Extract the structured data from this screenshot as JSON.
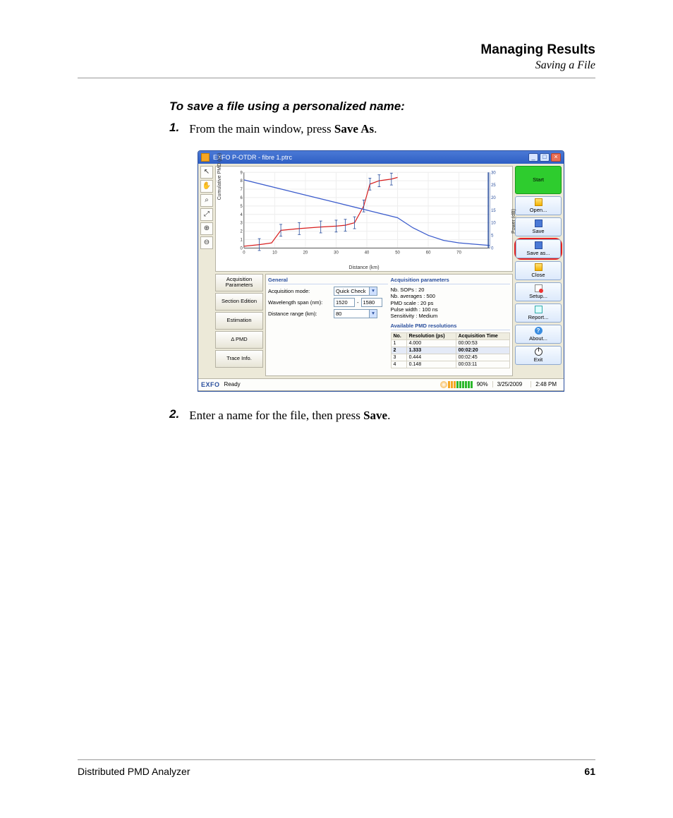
{
  "header": {
    "title": "Managing Results",
    "subtitle": "Saving a File"
  },
  "instruction_heading": "To save a file using a personalized name:",
  "steps": {
    "s1_num": "1.",
    "s1_pre": "From the main window, press ",
    "s1_b": "Save As",
    "s1_post": ".",
    "s2_num": "2.",
    "s2_pre": "Enter a name for the file, then press ",
    "s2_b": "Save",
    "s2_post": "."
  },
  "window": {
    "title": "EXFO P-OTDR - fibre 1.ptrc"
  },
  "chart_data": {
    "type": "line",
    "xlabel": "Distance (km)",
    "ylabel": "Cumulative PMD (ps)",
    "y2label": "Power (dB)",
    "xlim": [
      0,
      80
    ],
    "ylim": [
      0,
      9
    ],
    "y2lim": [
      0,
      30
    ],
    "x_ticks": [
      0,
      10,
      20,
      30,
      40,
      50,
      60,
      70
    ],
    "y_ticks": [
      0,
      1,
      2,
      3,
      4,
      5,
      6,
      7,
      8,
      9
    ],
    "y2_ticks": [
      0,
      5,
      10,
      15,
      20,
      25,
      30
    ],
    "series": [
      {
        "name": "Cumulative PMD",
        "axis": "y",
        "color": "#d81e1e",
        "x": [
          0,
          5,
          9,
          12,
          18,
          25,
          30,
          33,
          36,
          39,
          41,
          44,
          48,
          50
        ],
        "values": [
          0.2,
          0.4,
          0.6,
          2.1,
          2.3,
          2.5,
          2.6,
          2.7,
          3.0,
          5.0,
          7.6,
          8.0,
          8.2,
          8.4
        ]
      },
      {
        "name": "Power",
        "axis": "y2",
        "color": "#3a5bcc",
        "x": [
          0,
          10,
          20,
          30,
          40,
          50,
          55,
          60,
          65,
          70,
          75,
          80
        ],
        "values": [
          27,
          24,
          21,
          18,
          15,
          12,
          8,
          5,
          3,
          2,
          1.5,
          1
        ]
      }
    ],
    "error_bars_at_x": [
      5,
      12,
      18,
      25,
      30,
      33,
      36,
      39,
      41,
      44,
      48
    ]
  },
  "tools": [
    "pointer",
    "hand",
    "zoom-region",
    "zoom-fit",
    "zoom-in",
    "zoom-out"
  ],
  "tool_glyph": {
    "pointer": "↖",
    "hand": "✋",
    "zoom-region": "⌕",
    "zoom-fit": "⤢",
    "zoom-in": "⊕",
    "zoom-out": "⊖"
  },
  "tabs": {
    "t0": "Acquisition Parameters",
    "t1": "Section Edition",
    "t2": "Estimation",
    "t3": "Δ PMD",
    "t4": "Trace Info."
  },
  "general": {
    "title": "General",
    "acq_mode_label": "Acquisition mode:",
    "acq_mode_value": "Quick Check",
    "wl_label": "Wavelength span (nm):",
    "wl_from": "1520",
    "wl_sep": "-",
    "wl_to": "1580",
    "dist_label": "Distance range (km):",
    "dist_value": "80"
  },
  "acq": {
    "title": "Acquisition parameters",
    "l0": "Nb. SOPs : 20",
    "l1": "Nb. averages : 500",
    "l2": "PMD scale : 20 ps",
    "l3": "Pulse width : 100 ns",
    "l4": "Sensitivity : Medium"
  },
  "res": {
    "title": "Available PMD resolutions",
    "h0": "No.",
    "h1": "Resolution (ps)",
    "h2": "Acquisition Time",
    "rows": [
      {
        "n": "1",
        "r": "4.000",
        "t": "00:00:53",
        "sel": false
      },
      {
        "n": "2",
        "r": "1.333",
        "t": "00:02:20",
        "sel": true
      },
      {
        "n": "3",
        "r": "0.444",
        "t": "00:02:45",
        "sel": false
      },
      {
        "n": "4",
        "r": "0.148",
        "t": "00:03:11",
        "sel": false
      }
    ]
  },
  "buttons": {
    "start": "Start",
    "open": "Open...",
    "save": "Save",
    "save_as": "Save as...",
    "close": "Close",
    "setup": "Setup...",
    "report": "Report...",
    "about": "About...",
    "exit": "Exit"
  },
  "status": {
    "brand": "EXFO",
    "state": "Ready",
    "battery": "90%",
    "date": "3/25/2009",
    "time": "2:48 PM"
  },
  "footer": {
    "left": "Distributed PMD Analyzer",
    "right": "61"
  }
}
